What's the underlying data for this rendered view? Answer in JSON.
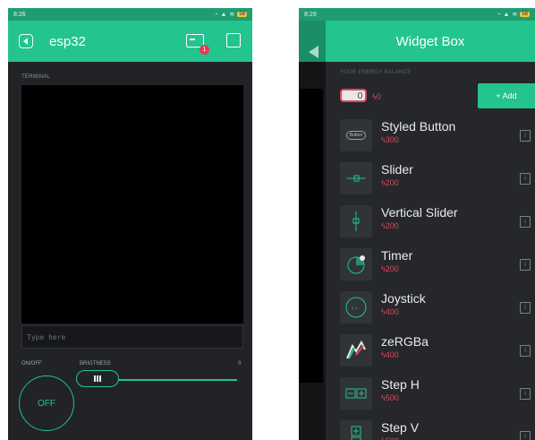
{
  "left": {
    "status_time": "8:26",
    "status_batt": "58",
    "project_name": "esp32",
    "notification_count": "1",
    "terminal_label": "TERMINAL",
    "input_placeholder": "Type here",
    "switch_label": "ON/OFF",
    "switch_state": "OFF",
    "slider_label": "BRIGTNESS",
    "slider_value": "0"
  },
  "right": {
    "status_time": "8:29",
    "status_batt": "58",
    "title": "Widget Box",
    "energy_label": "YOUR ENERGY BALANCE",
    "energy_value": "0",
    "add_label": "+ Add",
    "widgets": [
      {
        "name": "Styled Button",
        "cost": "300",
        "icon": "styled-button-icon"
      },
      {
        "name": "Slider",
        "cost": "200",
        "icon": "slider-icon"
      },
      {
        "name": "Vertical Slider",
        "cost": "200",
        "icon": "vertical-slider-icon"
      },
      {
        "name": "Timer",
        "cost": "200",
        "icon": "timer-icon"
      },
      {
        "name": "Joystick",
        "cost": "400",
        "icon": "joystick-icon"
      },
      {
        "name": "zeRGBa",
        "cost": "400",
        "icon": "zergba-icon"
      },
      {
        "name": "Step H",
        "cost": "500",
        "icon": "step-h-icon"
      },
      {
        "name": "Step V",
        "cost": "500",
        "icon": "step-v-icon"
      }
    ],
    "button_icon_text": "Button"
  },
  "colors": {
    "accent": "#23c48e",
    "background": "#212326",
    "cost": "#e1475b"
  }
}
